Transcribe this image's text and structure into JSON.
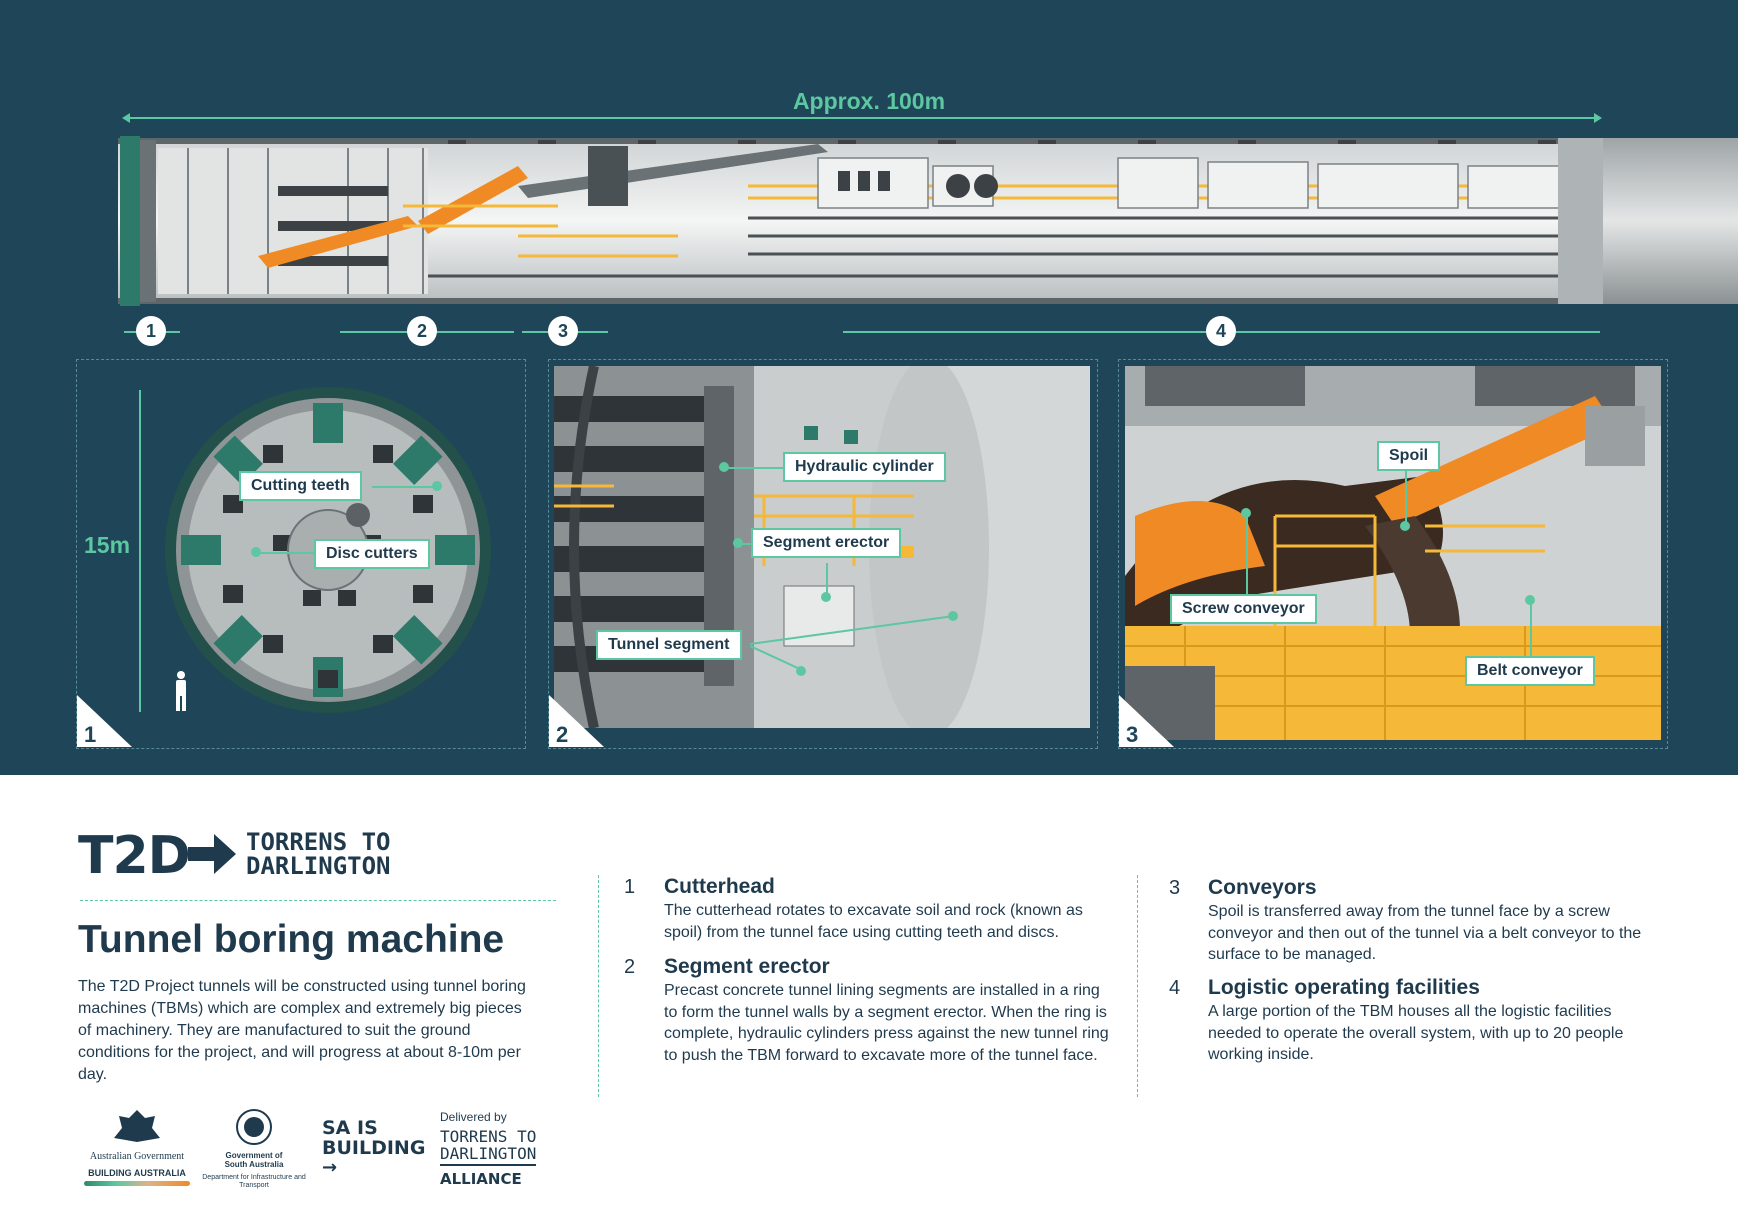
{
  "dimensions": {
    "length_label": "Approx. 100m",
    "diameter_label": "15m"
  },
  "section_markers": [
    "1",
    "2",
    "3",
    "4"
  ],
  "panels": [
    {
      "number": "1",
      "callouts": [
        "Cutting teeth",
        "Disc cutters"
      ]
    },
    {
      "number": "2",
      "callouts": [
        "Hydraulic cylinder",
        "Segment erector",
        "Tunnel segment"
      ]
    },
    {
      "number": "3",
      "callouts": [
        "Spoil",
        "Screw conveyor",
        "Belt conveyor"
      ]
    }
  ],
  "brand": {
    "mark": "T2D",
    "name_line1": "TORRENS TO",
    "name_line2": "DARLINGTON"
  },
  "heading": "Tunnel boring machine",
  "intro": "The T2D Project tunnels will be constructed using tunnel boring machines (TBMs) which are complex and extremely big pieces of machinery. They are manufactured to suit the ground conditions for the project, and will progress at about 8-10m per day.",
  "items": [
    {
      "num": "1",
      "title": "Cutterhead",
      "text": "The cutterhead rotates to excavate soil and rock (known as spoil) from the tunnel face using cutting teeth and discs."
    },
    {
      "num": "2",
      "title": "Segment erector",
      "text": "Precast concrete tunnel lining segments are installed in a ring to form the tunnel walls by a segment erector. When the ring is complete, hydraulic cylinders press against the new tunnel ring to push the TBM forward to excavate more of the tunnel face."
    },
    {
      "num": "3",
      "title": "Conveyors",
      "text": "Spoil is transferred away from the tunnel face by a screw conveyor and then out of the tunnel via a belt conveyor to the surface to be managed."
    },
    {
      "num": "4",
      "title": "Logistic operating facilities",
      "text": "A large portion of the TBM houses all the logistic facilities needed to operate the overall system, with up to 20 people working inside."
    }
  ],
  "logos": {
    "aus_gov": "Australian Government",
    "aus_gov_sub": "BUILDING AUSTRALIA",
    "sa_gov": "Government of South Australia",
    "sa_gov_sub": "Department for Infrastructure and Transport",
    "sa_building_1": "SA IS",
    "sa_building_2": "BUILDING",
    "delivered_by": "Delivered by",
    "alliance_1": "TORRENS TO",
    "alliance_2": "DARLINGTON",
    "alliance_3": "ALLIANCE"
  },
  "colors": {
    "navy": "#1e4558",
    "accent_green": "#5cc7a0",
    "orange": "#f08a24",
    "yellow": "#f5b838",
    "text": "#1f3a4d"
  }
}
